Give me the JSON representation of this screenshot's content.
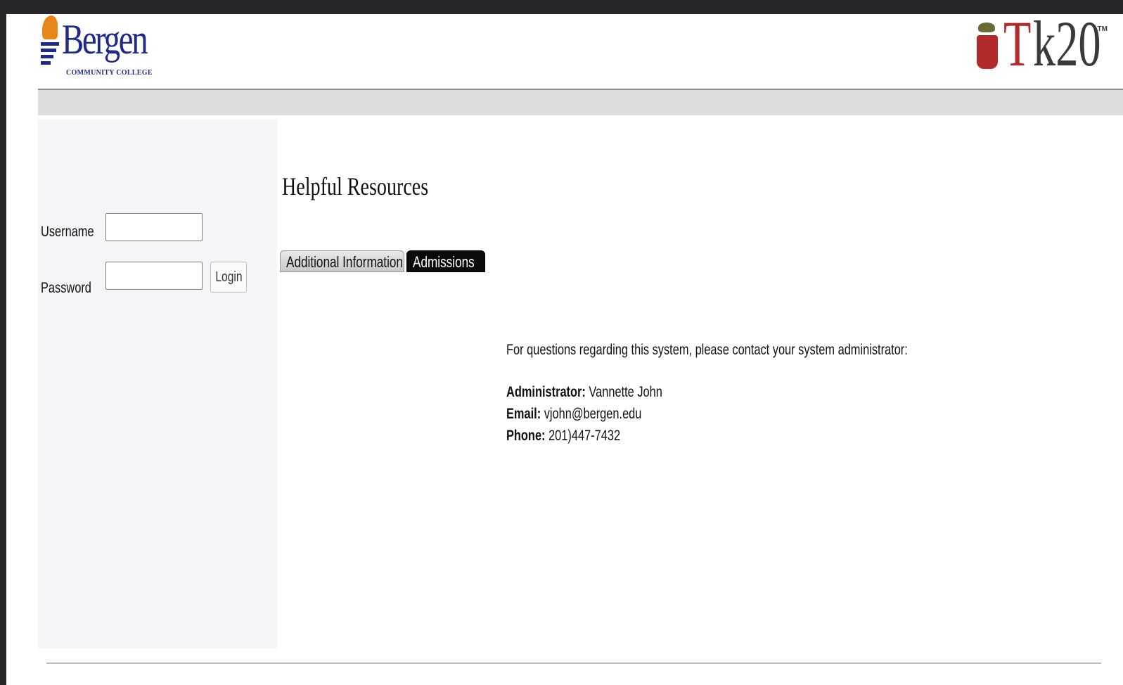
{
  "header": {
    "bergen_logo_text": "Bergen",
    "bergen_logo_sub": "COMMUNITY COLLEGE",
    "tk20_logo_text": "Tk20",
    "tk20_tm": "TM"
  },
  "login": {
    "username_label": "Username",
    "password_label": "Password",
    "login_button": "Login",
    "username_value": "",
    "password_value": ""
  },
  "content": {
    "title": "Helpful Resources",
    "tabs": [
      {
        "label": "Additional Information",
        "active": false
      },
      {
        "label": "Admissions",
        "active": true
      }
    ],
    "intro": "For questions regarding this system, please contact your system administrator:",
    "administrator_label": "Administrator:",
    "administrator_value": "Vannette John",
    "email_label": "Email:",
    "email_value": "vjohn@bergen.edu",
    "phone_label": "Phone:",
    "phone_value": "201)447-7432"
  },
  "colors": {
    "bergen_blue": "#1d2a8c",
    "bergen_orange": "#e8861c",
    "tk20_red": "#b22a2a",
    "sidebar_bg": "#f4f4f9",
    "navbar_bg": "#dcdcdc"
  }
}
